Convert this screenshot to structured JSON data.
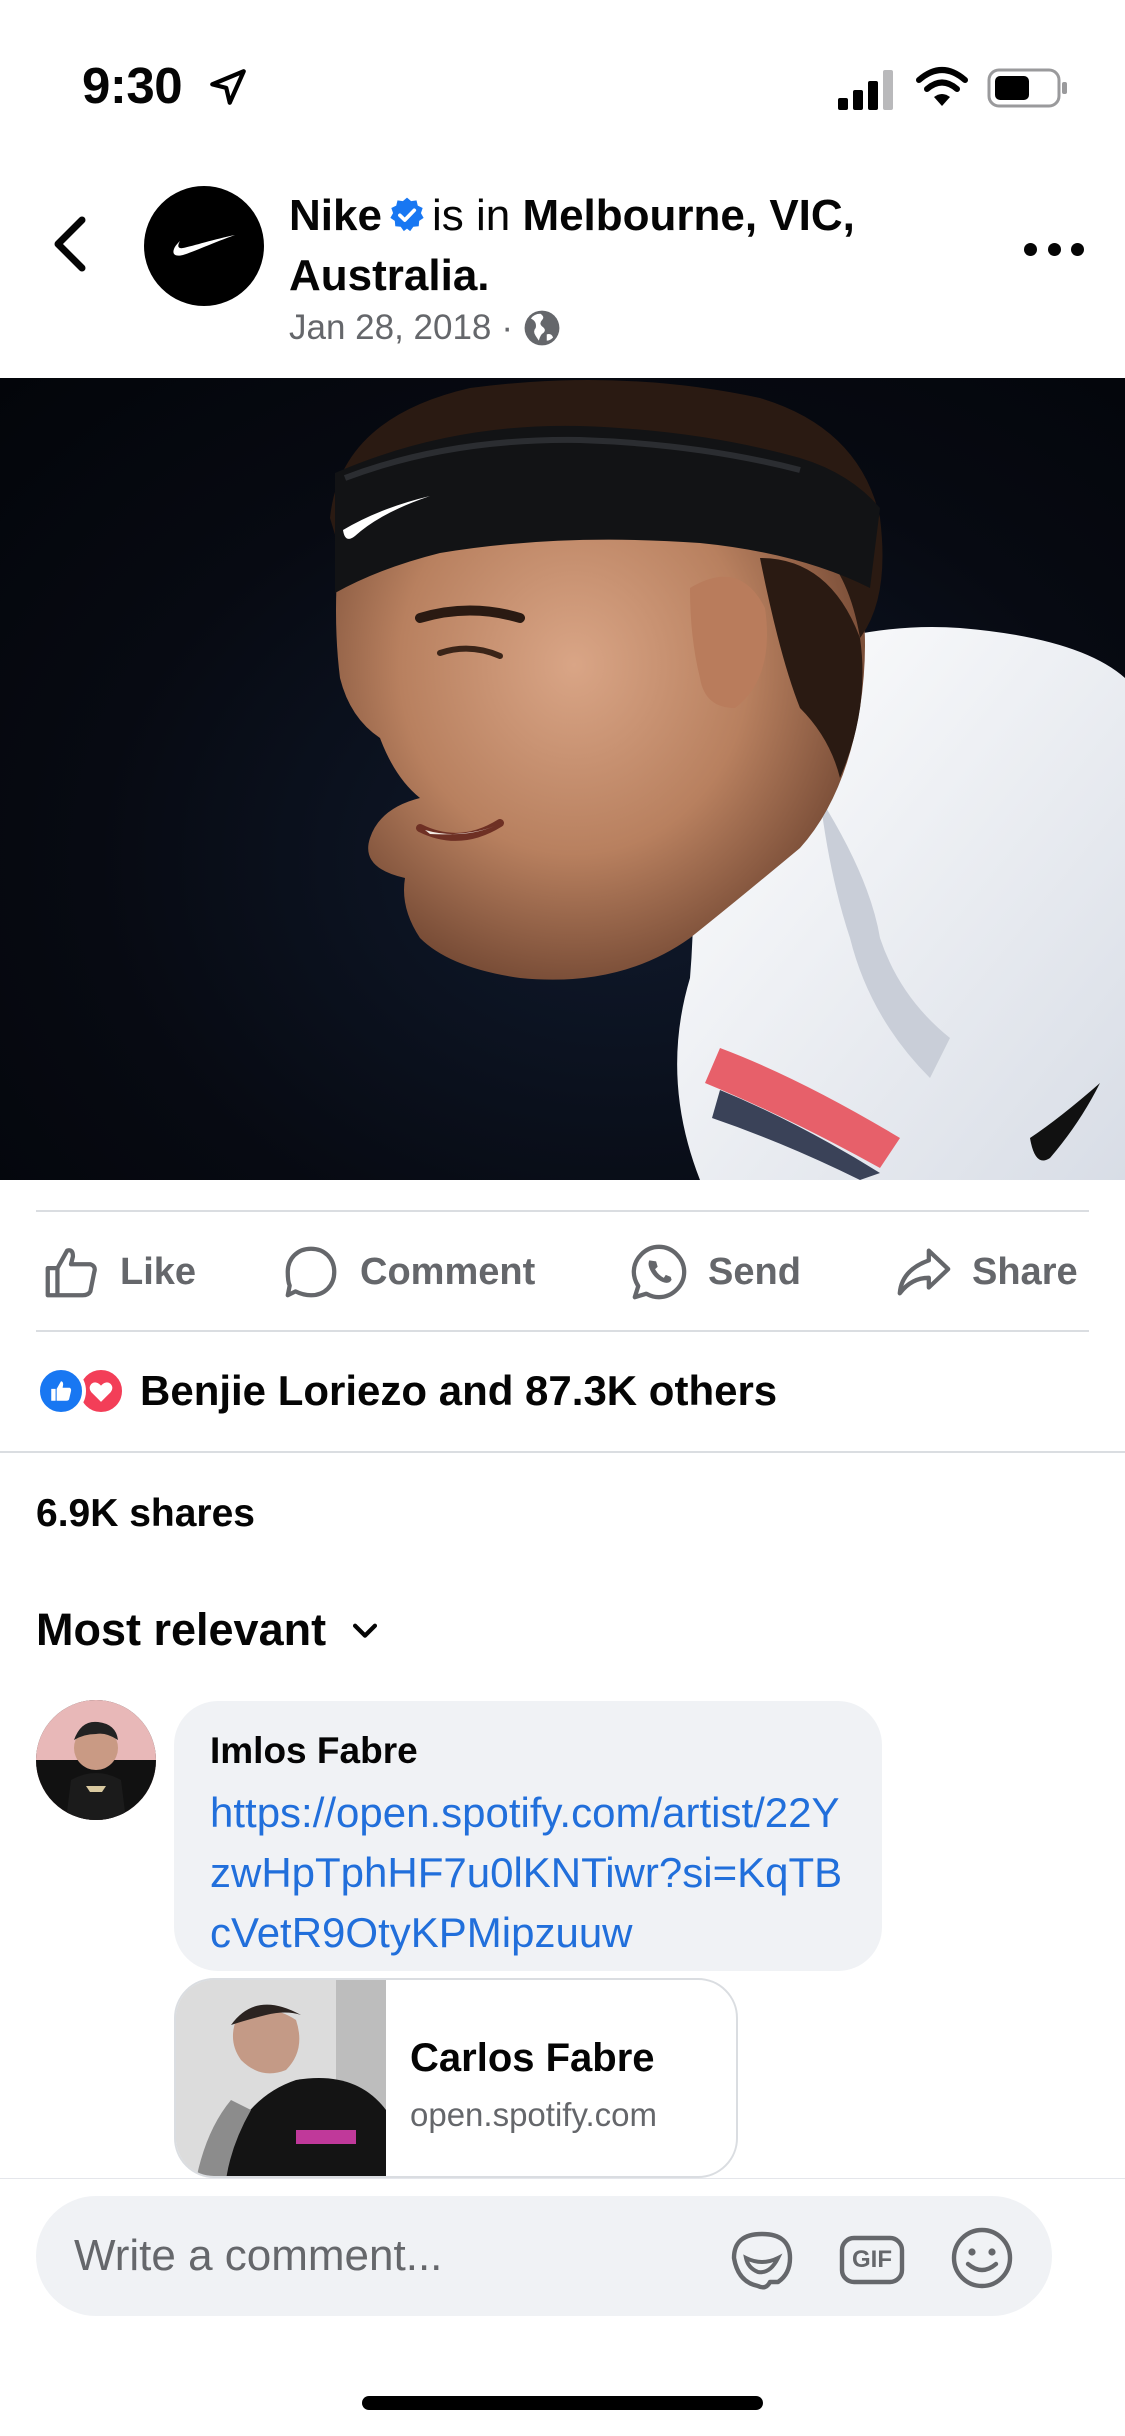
{
  "status_bar": {
    "time": "9:30",
    "icons": [
      "location-arrow-icon",
      "signal-icon",
      "wifi-icon",
      "battery-icon"
    ]
  },
  "post": {
    "page_name": "Nike",
    "verified": true,
    "is_in_text": "is in",
    "location": "Melbourne, VIC, Australia.",
    "date": "Jan 28, 2018",
    "separator": "·",
    "privacy_icon": "globe-icon"
  },
  "actions": {
    "like": "Like",
    "comment": "Comment",
    "send": "Send",
    "share": "Share"
  },
  "reactions": {
    "types": [
      "like",
      "love"
    ],
    "summary": "Benjie Loriezo and 87.3K others"
  },
  "shares": "6.9K shares",
  "sort": {
    "label": "Most relevant"
  },
  "comments": [
    {
      "author": "Imlos Fabre",
      "text": "https://open.spotify.com/artist/22YzwHpTphHF7u0lKNTiwr?si=KqTBcVetR9OtyKPMipzuuw",
      "link_preview": {
        "title": "Carlos Fabre",
        "domain": "open.spotify.com"
      }
    }
  ],
  "composer": {
    "placeholder": "Write a comment...",
    "icons": [
      "sticker-icon",
      "gif-icon",
      "emoji-icon"
    ],
    "gif_label": "GIF"
  },
  "colors": {
    "accent": "#1877f2",
    "link": "#216fdb",
    "love": "#f33e58",
    "secondary_text": "#65676b"
  }
}
